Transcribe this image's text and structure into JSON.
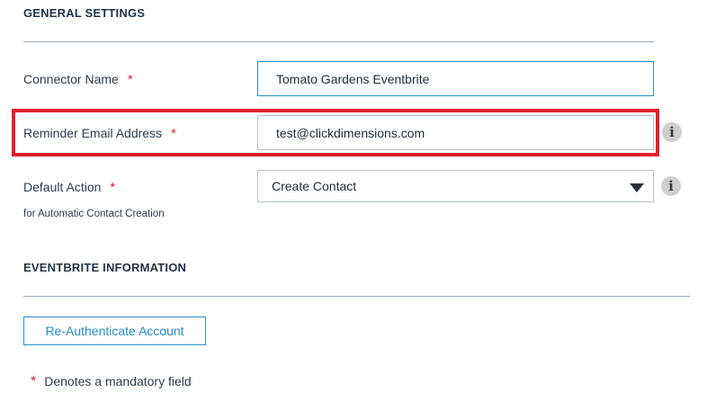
{
  "general": {
    "title": "GENERAL SETTINGS",
    "connector_name": {
      "label": "Connector Name",
      "required": "*",
      "value": "Tomato Gardens Eventbrite"
    },
    "reminder_email": {
      "label": "Reminder Email Address",
      "required": "*",
      "value": "test@clickdimensions.com"
    },
    "default_action": {
      "label": "Default Action",
      "required": "*",
      "sublabel": "for Automatic Contact Creation",
      "value": "Create Contact"
    },
    "info_glyph": "i"
  },
  "eventbrite": {
    "title": "EVENTBRITE INFORMATION",
    "reauth_button": "Re-Authenticate Account"
  },
  "footer": {
    "star": "*",
    "note": "Denotes a mandatory field"
  },
  "colors": {
    "required": "#d81f3a",
    "highlight": "#e0202e",
    "button_text": "#2a8ac4",
    "divider": "#9aa6c4"
  },
  "icons": {
    "info": "info-icon",
    "dropdown": "chevron-down-icon"
  }
}
